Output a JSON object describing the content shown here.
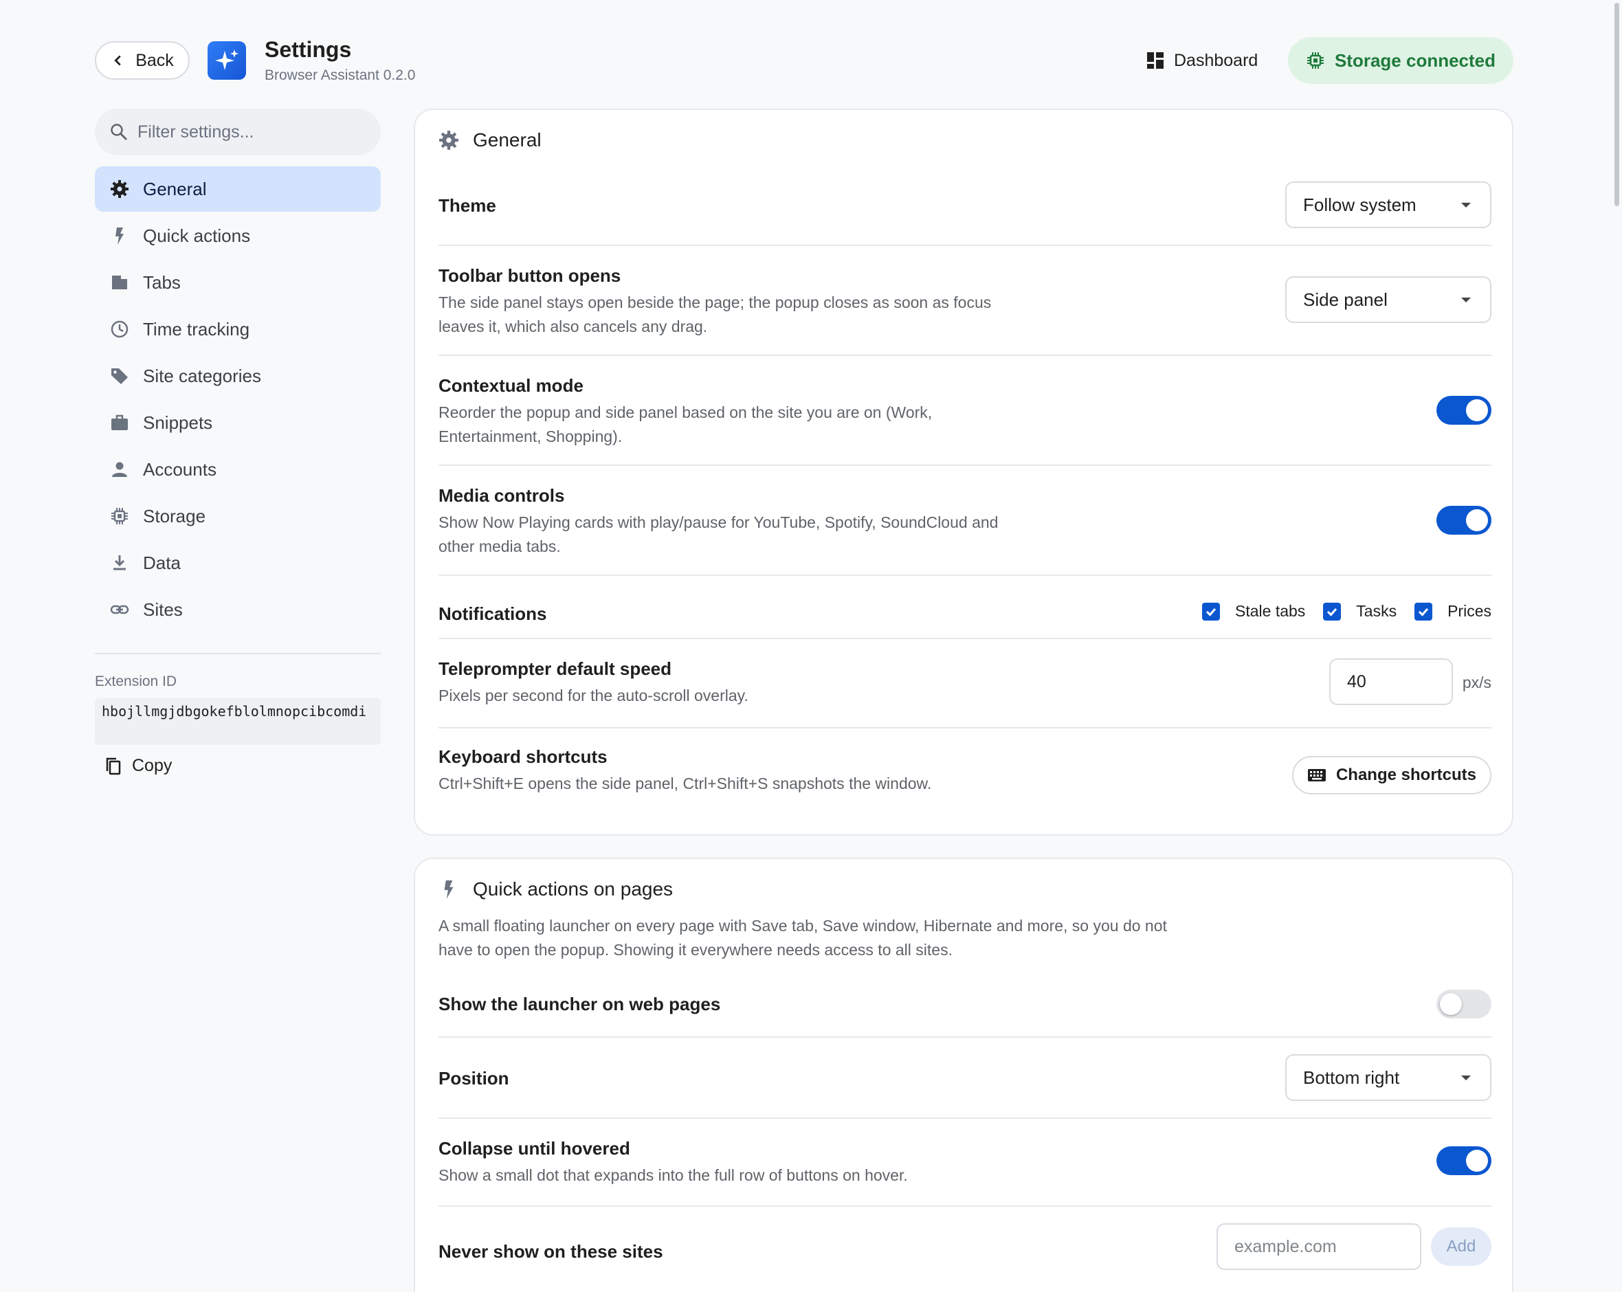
{
  "header": {
    "back_label": "Back",
    "title": "Settings",
    "subtitle": "Browser Assistant 0.2.0",
    "dashboard_label": "Dashboard",
    "storage_status": "Storage connected"
  },
  "colors": {
    "accent": "#0b57d0",
    "active_nav": "#d3e3fd",
    "status_bg": "#dff3e4",
    "status_text": "#1e7a3c"
  },
  "sidebar": {
    "search_placeholder": "Filter settings...",
    "items": [
      {
        "label": "General",
        "icon": "gear-icon",
        "active": true
      },
      {
        "label": "Quick actions",
        "icon": "bolt-icon"
      },
      {
        "label": "Tabs",
        "icon": "tab-icon"
      },
      {
        "label": "Time tracking",
        "icon": "clock-icon"
      },
      {
        "label": "Site categories",
        "icon": "tag-icon"
      },
      {
        "label": "Snippets",
        "icon": "briefcase-icon"
      },
      {
        "label": "Accounts",
        "icon": "person-icon"
      },
      {
        "label": "Storage",
        "icon": "chip-icon"
      },
      {
        "label": "Data",
        "icon": "download-icon"
      },
      {
        "label": "Sites",
        "icon": "link-icon"
      }
    ],
    "extension_label": "Extension ID",
    "extension_id": "hbojllmgjdbgokefblolmnopcibcomdi",
    "copy_label": "Copy"
  },
  "general": {
    "title": "General",
    "theme": {
      "label": "Theme",
      "value": "Follow system"
    },
    "toolbar": {
      "label": "Toolbar button opens",
      "desc": "The side panel stays open beside the page; the popup closes as soon as focus leaves it, which also cancels any drag.",
      "value": "Side panel"
    },
    "contextual": {
      "label": "Contextual mode",
      "desc": "Reorder the popup and side panel based on the site you are on (Work, Entertainment, Shopping).",
      "enabled": true
    },
    "media": {
      "label": "Media controls",
      "desc": "Show Now Playing cards with play/pause for YouTube, Spotify, SoundCloud and other media tabs.",
      "enabled": true
    },
    "notifications": {
      "label": "Notifications",
      "options": [
        {
          "label": "Stale tabs",
          "checked": true
        },
        {
          "label": "Tasks",
          "checked": true
        },
        {
          "label": "Prices",
          "checked": true
        }
      ]
    },
    "teleprompter": {
      "label": "Teleprompter default speed",
      "desc": "Pixels per second for the auto-scroll overlay.",
      "value": "40",
      "unit": "px/s"
    },
    "shortcuts": {
      "label": "Keyboard shortcuts",
      "desc": "Ctrl+Shift+E opens the side panel, Ctrl+Shift+S snapshots the window.",
      "button": "Change shortcuts"
    }
  },
  "quick": {
    "title": "Quick actions on pages",
    "desc": "A small floating launcher on every page with Save tab, Save window, Hibernate and more, so you do not have to open the popup. Showing it everywhere needs access to all sites.",
    "launcher": {
      "label": "Show the launcher on web pages",
      "enabled": false
    },
    "position": {
      "label": "Position",
      "value": "Bottom right"
    },
    "collapse": {
      "label": "Collapse until hovered",
      "desc": "Show a small dot that expands into the full row of buttons on hover.",
      "enabled": true
    },
    "never": {
      "label": "Never show on these sites",
      "placeholder": "example.com",
      "add_label": "Add"
    }
  }
}
